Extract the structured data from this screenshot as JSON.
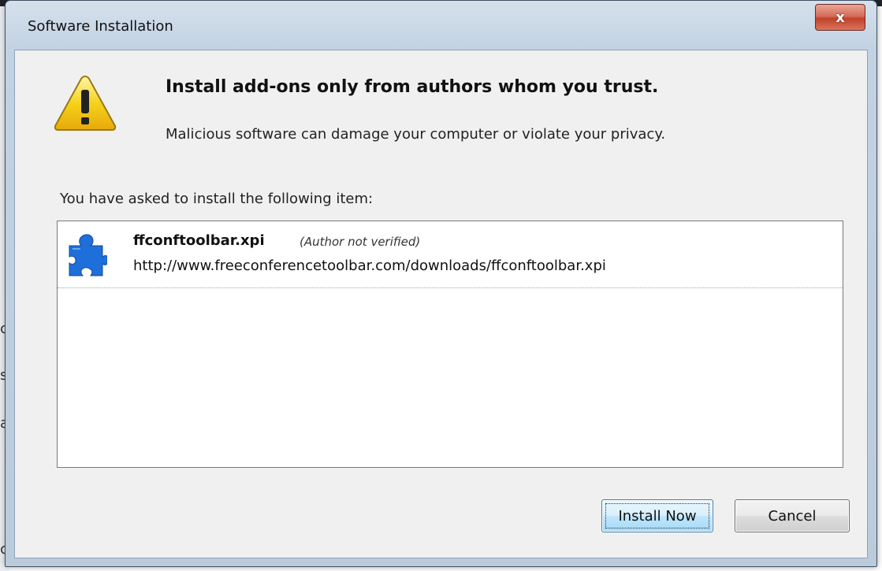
{
  "window": {
    "title": "Software Installation",
    "close_glyph": "x"
  },
  "warning": {
    "headline": "Install add-ons only from authors whom you trust.",
    "subline": "Malicious software can damage your computer or violate your privacy.",
    "icon": "warning-triangle-icon"
  },
  "ask_label": "You have asked to install the following item:",
  "items": [
    {
      "name": "ffconftoolbar.xpi",
      "status": "(Author not verified)",
      "url": "http://www.freeconferencetoolbar.com/downloads/ffconftoolbar.xpi",
      "icon": "puzzle-piece-icon"
    }
  ],
  "buttons": {
    "install_label": "Install Now",
    "cancel_label": "Cancel"
  },
  "background_fragments": [
    "c",
    "s",
    "a",
    "c"
  ],
  "colors": {
    "puzzle_blue": "#1e6fd9",
    "warning_yellow": "#f5d21c",
    "close_red": "#c1412b"
  }
}
